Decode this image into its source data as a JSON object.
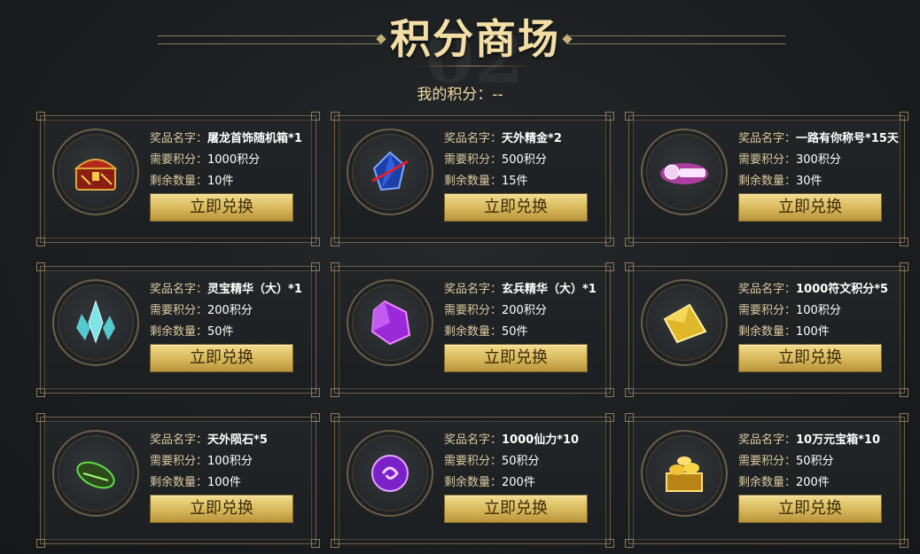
{
  "header": {
    "title": "积分商场",
    "my_points_label": "我的积分：",
    "my_points_value": "--"
  },
  "labels": {
    "name": "奖品名字：",
    "cost": "需要积分：",
    "stock": "剩余数量："
  },
  "colors": {
    "accent_gold": "#f3dfa6",
    "button_gold": "#d6b75a",
    "card_border": "#6f6046"
  },
  "items": [
    {
      "name": "屠龙首饰随机箱*1",
      "cost": "1000积分",
      "stock": "10件",
      "button": "立即兑换",
      "icon": "treasure-chest-icon"
    },
    {
      "name": "天外精金*2",
      "cost": "500积分",
      "stock": "15件",
      "button": "立即兑换",
      "icon": "blue-crystal-icon"
    },
    {
      "name": "一路有你称号*15天",
      "cost": "300积分",
      "stock": "30件",
      "button": "立即兑换",
      "icon": "title-badge-icon"
    },
    {
      "name": "灵宝精华（大）*1",
      "cost": "200积分",
      "stock": "50件",
      "button": "立即兑换",
      "icon": "ice-crystal-icon"
    },
    {
      "name": "玄兵精华（大）*1",
      "cost": "200积分",
      "stock": "50件",
      "button": "立即兑换",
      "icon": "purple-gem-icon"
    },
    {
      "name": "1000符文积分*5",
      "cost": "100积分",
      "stock": "100件",
      "button": "立即兑换",
      "icon": "gold-points-icon"
    },
    {
      "name": "天外陨石*5",
      "cost": "100积分",
      "stock": "100件",
      "button": "立即兑换",
      "icon": "green-meteorite-icon"
    },
    {
      "name": "1000仙力*10",
      "cost": "50积分",
      "stock": "200件",
      "button": "立即兑换",
      "icon": "purple-orb-icon"
    },
    {
      "name": "10万元宝箱*10",
      "cost": "50积分",
      "stock": "200件",
      "button": "立即兑换",
      "icon": "gold-ingot-chest-icon"
    }
  ]
}
